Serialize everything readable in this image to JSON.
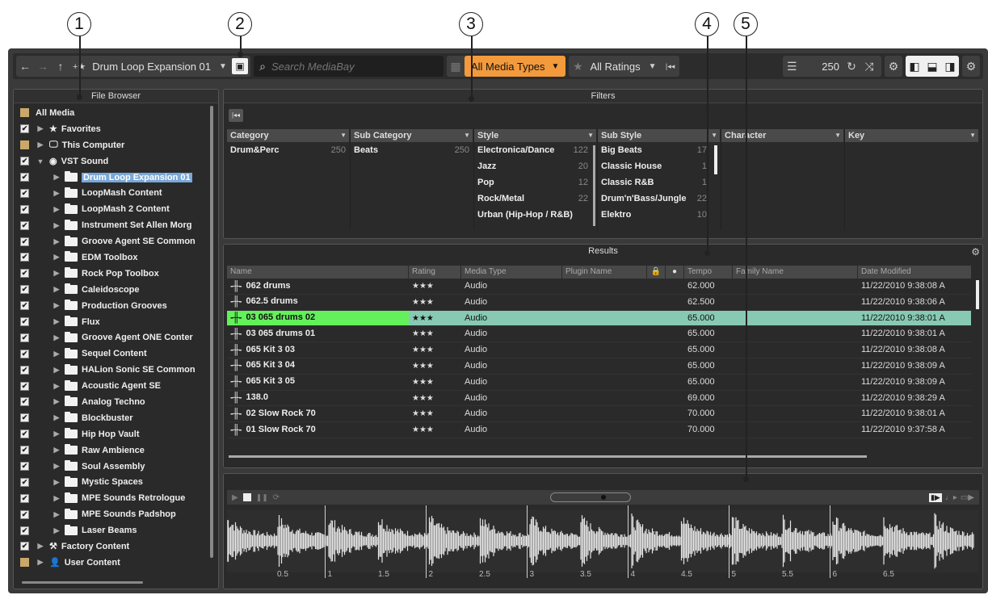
{
  "callouts": [
    "1",
    "2",
    "3",
    "4",
    "5"
  ],
  "toolbar": {
    "preset": "Drum Loop Expansion 01",
    "search_placeholder": "Search MediaBay",
    "media_types": "All Media Types",
    "ratings": "All Ratings",
    "results_count": "250"
  },
  "file_browser": {
    "title": "File Browser",
    "root": "All Media",
    "favorites": "Favorites",
    "this_computer": "This Computer",
    "vst_sound": "VST Sound",
    "items": [
      "Drum Loop Expansion 01",
      "LoopMash Content",
      "LoopMash 2 Content",
      "Instrument Set Allen Morg",
      "Groove Agent SE Common",
      "EDM Toolbox",
      "Rock Pop Toolbox",
      "Caleidoscope",
      "Production Grooves",
      "Flux",
      "Groove Agent ONE Conter",
      "Sequel Content",
      "HALion Sonic SE Common",
      "Acoustic Agent SE",
      "Analog Techno",
      "Blockbuster",
      "Hip Hop Vault",
      "Raw Ambience",
      "Soul Assembly",
      "Mystic Spaces",
      "MPE Sounds Retrologue",
      "MPE Sounds Padshop",
      "Laser Beams"
    ],
    "factory_content": "Factory Content",
    "user_content": "User Content"
  },
  "filters": {
    "title": "Filters",
    "columns": {
      "category": "Category",
      "sub_category": "Sub Category",
      "style": "Style",
      "sub_style": "Sub Style",
      "character": "Character",
      "key": "Key"
    },
    "category_item": {
      "name": "Drum&Perc",
      "count": "250"
    },
    "sub_category_item": {
      "name": "Beats",
      "count": "250"
    },
    "styles": [
      {
        "name": "Electronica/Dance",
        "count": "122"
      },
      {
        "name": "Jazz",
        "count": "20"
      },
      {
        "name": "Pop",
        "count": "12"
      },
      {
        "name": "Rock/Metal",
        "count": "22"
      },
      {
        "name": "Urban (Hip-Hop / R&B)",
        "count": ""
      }
    ],
    "sub_styles": [
      {
        "name": "Big Beats",
        "count": "17"
      },
      {
        "name": "Classic House",
        "count": "1"
      },
      {
        "name": "Classic R&B",
        "count": "1"
      },
      {
        "name": "Drum'n'Bass/Jungle",
        "count": "22"
      },
      {
        "name": "Elektro",
        "count": "10"
      }
    ]
  },
  "results": {
    "title": "Results",
    "headers": {
      "name": "Name",
      "rating": "Rating",
      "media_type": "Media Type",
      "plugin": "Plugin Name",
      "tempo": "Tempo",
      "family": "Family Name",
      "date": "Date Modified"
    },
    "rows": [
      {
        "name": "062 drums",
        "rating": "★★★",
        "type": "Audio",
        "tempo": "62.000",
        "date": "11/22/2010 9:38:08 A"
      },
      {
        "name": "062.5 drums",
        "rating": "★★★",
        "type": "Audio",
        "tempo": "62.500",
        "date": "11/22/2010 9:38:06 A"
      },
      {
        "name": "03 065 drums 02",
        "rating": "★★★",
        "type": "Audio",
        "tempo": "65.000",
        "date": "11/22/2010 9:38:01 A"
      },
      {
        "name": "03 065 drums 01",
        "rating": "★★★",
        "type": "Audio",
        "tempo": "65.000",
        "date": "11/22/2010 9:38:01 A"
      },
      {
        "name": "065 Kit 3 03",
        "rating": "★★★",
        "type": "Audio",
        "tempo": "65.000",
        "date": "11/22/2010 9:38:08 A"
      },
      {
        "name": "065 Kit 3 04",
        "rating": "★★★",
        "type": "Audio",
        "tempo": "65.000",
        "date": "11/22/2010 9:38:09 A"
      },
      {
        "name": "065 Kit 3 05",
        "rating": "★★★",
        "type": "Audio",
        "tempo": "65.000",
        "date": "11/22/2010 9:38:09 A"
      },
      {
        "name": "138.0",
        "rating": "★★★",
        "type": "Audio",
        "tempo": "69.000",
        "date": "11/22/2010 9:38:29 A"
      },
      {
        "name": "02 Slow Rock 70",
        "rating": "★★★",
        "type": "Audio",
        "tempo": "70.000",
        "date": "11/22/2010 9:38:01 A"
      },
      {
        "name": "01 Slow Rock 70",
        "rating": "★★★",
        "type": "Audio",
        "tempo": "70.000",
        "date": "11/22/2010 9:37:58 A"
      }
    ]
  },
  "preview": {
    "ruler": [
      "0.5",
      "1",
      "1.5",
      "2",
      "2.5",
      "3",
      "3.5",
      "4",
      "4.5",
      "5",
      "5.5",
      "6",
      "6.5"
    ]
  }
}
